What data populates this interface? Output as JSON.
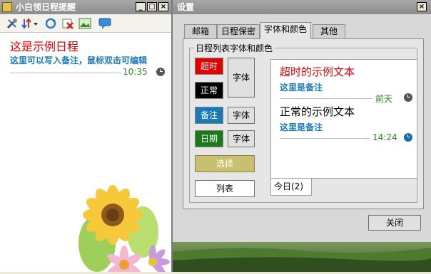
{
  "left_window": {
    "title": "小白领日程提醒",
    "controls": {
      "minimize": "_",
      "maximize": "□",
      "close": "×"
    },
    "entry": {
      "title": "这是示例日程",
      "note": "这里可以写入备注，鼠标双击可编辑",
      "time": "10:35"
    }
  },
  "right_window": {
    "title": "设置",
    "close": "×",
    "tabs": [
      "邮箱",
      "日程保密",
      "字体和颜色",
      "其他"
    ],
    "group_title": "日程列表字体和颜色",
    "swatches": {
      "overdue": "超时",
      "normal": "正常",
      "note": "备注",
      "date": "日期"
    },
    "buttons": {
      "font": "字体",
      "note_font": "字体",
      "date_font": "字体",
      "select": "选择",
      "list": "列表",
      "today": "今日(2)",
      "close": "关闭"
    },
    "preview": {
      "item1_title": "超时的示例文本",
      "item1_note": "这里是备注",
      "item1_date": "前天",
      "item2_title": "正常的示例文本",
      "item2_note": "这里是备注",
      "item2_time": "14:24"
    }
  },
  "colors": {
    "overdue": "#e00000",
    "normal": "#000000",
    "note": "#1a7ab8",
    "date": "#2a8a1a",
    "select_bg": "#c8c070"
  }
}
